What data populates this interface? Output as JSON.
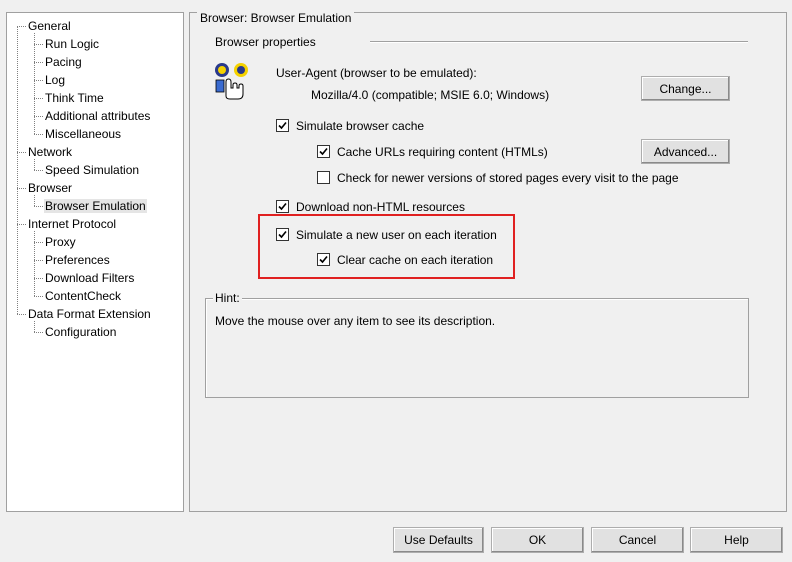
{
  "tree": {
    "items": [
      {
        "label": "General",
        "level": 0
      },
      {
        "label": "Run Logic",
        "level": 1
      },
      {
        "label": "Pacing",
        "level": 1
      },
      {
        "label": "Log",
        "level": 1
      },
      {
        "label": "Think Time",
        "level": 1
      },
      {
        "label": "Additional attributes",
        "level": 1
      },
      {
        "label": "Miscellaneous",
        "level": 1
      },
      {
        "label": "Network",
        "level": 0
      },
      {
        "label": "Speed Simulation",
        "level": 1
      },
      {
        "label": "Browser",
        "level": 0
      },
      {
        "label": "Browser Emulation",
        "level": 1,
        "selected": true
      },
      {
        "label": "Internet Protocol",
        "level": 0
      },
      {
        "label": "Proxy",
        "level": 1
      },
      {
        "label": "Preferences",
        "level": 1
      },
      {
        "label": "Download Filters",
        "level": 1
      },
      {
        "label": "ContentCheck",
        "level": 1
      },
      {
        "label": "Data Format Extension",
        "level": 0
      },
      {
        "label": "Configuration",
        "level": 1
      }
    ]
  },
  "panel": {
    "title": "Browser: Browser Emulation",
    "properties_heading": "Browser properties",
    "user_agent_label": "User-Agent (browser to be emulated):",
    "user_agent_value": "Mozilla/4.0 (compatible; MSIE 6.0; Windows)",
    "change_button": "Change...",
    "advanced_button": "Advanced...",
    "ua_icon": "hand-pointer-icon"
  },
  "options": {
    "simulate_cache": {
      "label": "Simulate browser cache",
      "checked": true
    },
    "cache_urls": {
      "label": "Cache URLs requiring content (HTMLs)",
      "checked": true
    },
    "check_newer": {
      "label": "Check for newer versions of stored pages every visit to the page",
      "checked": false
    },
    "download_non_html": {
      "label": "Download non-HTML resources",
      "checked": true
    },
    "simulate_new_user": {
      "label": "Simulate a new user on each iteration",
      "checked": true
    },
    "clear_cache": {
      "label": "Clear cache on each iteration",
      "checked": true
    }
  },
  "hint": {
    "title": "Hint:",
    "text": "Move the mouse over any item to see its description."
  },
  "footer": {
    "use_defaults": "Use Defaults",
    "ok": "OK",
    "cancel": "Cancel",
    "help": "Help"
  },
  "colors": {
    "highlight": "#e02020",
    "background": "#f0f0f0"
  }
}
